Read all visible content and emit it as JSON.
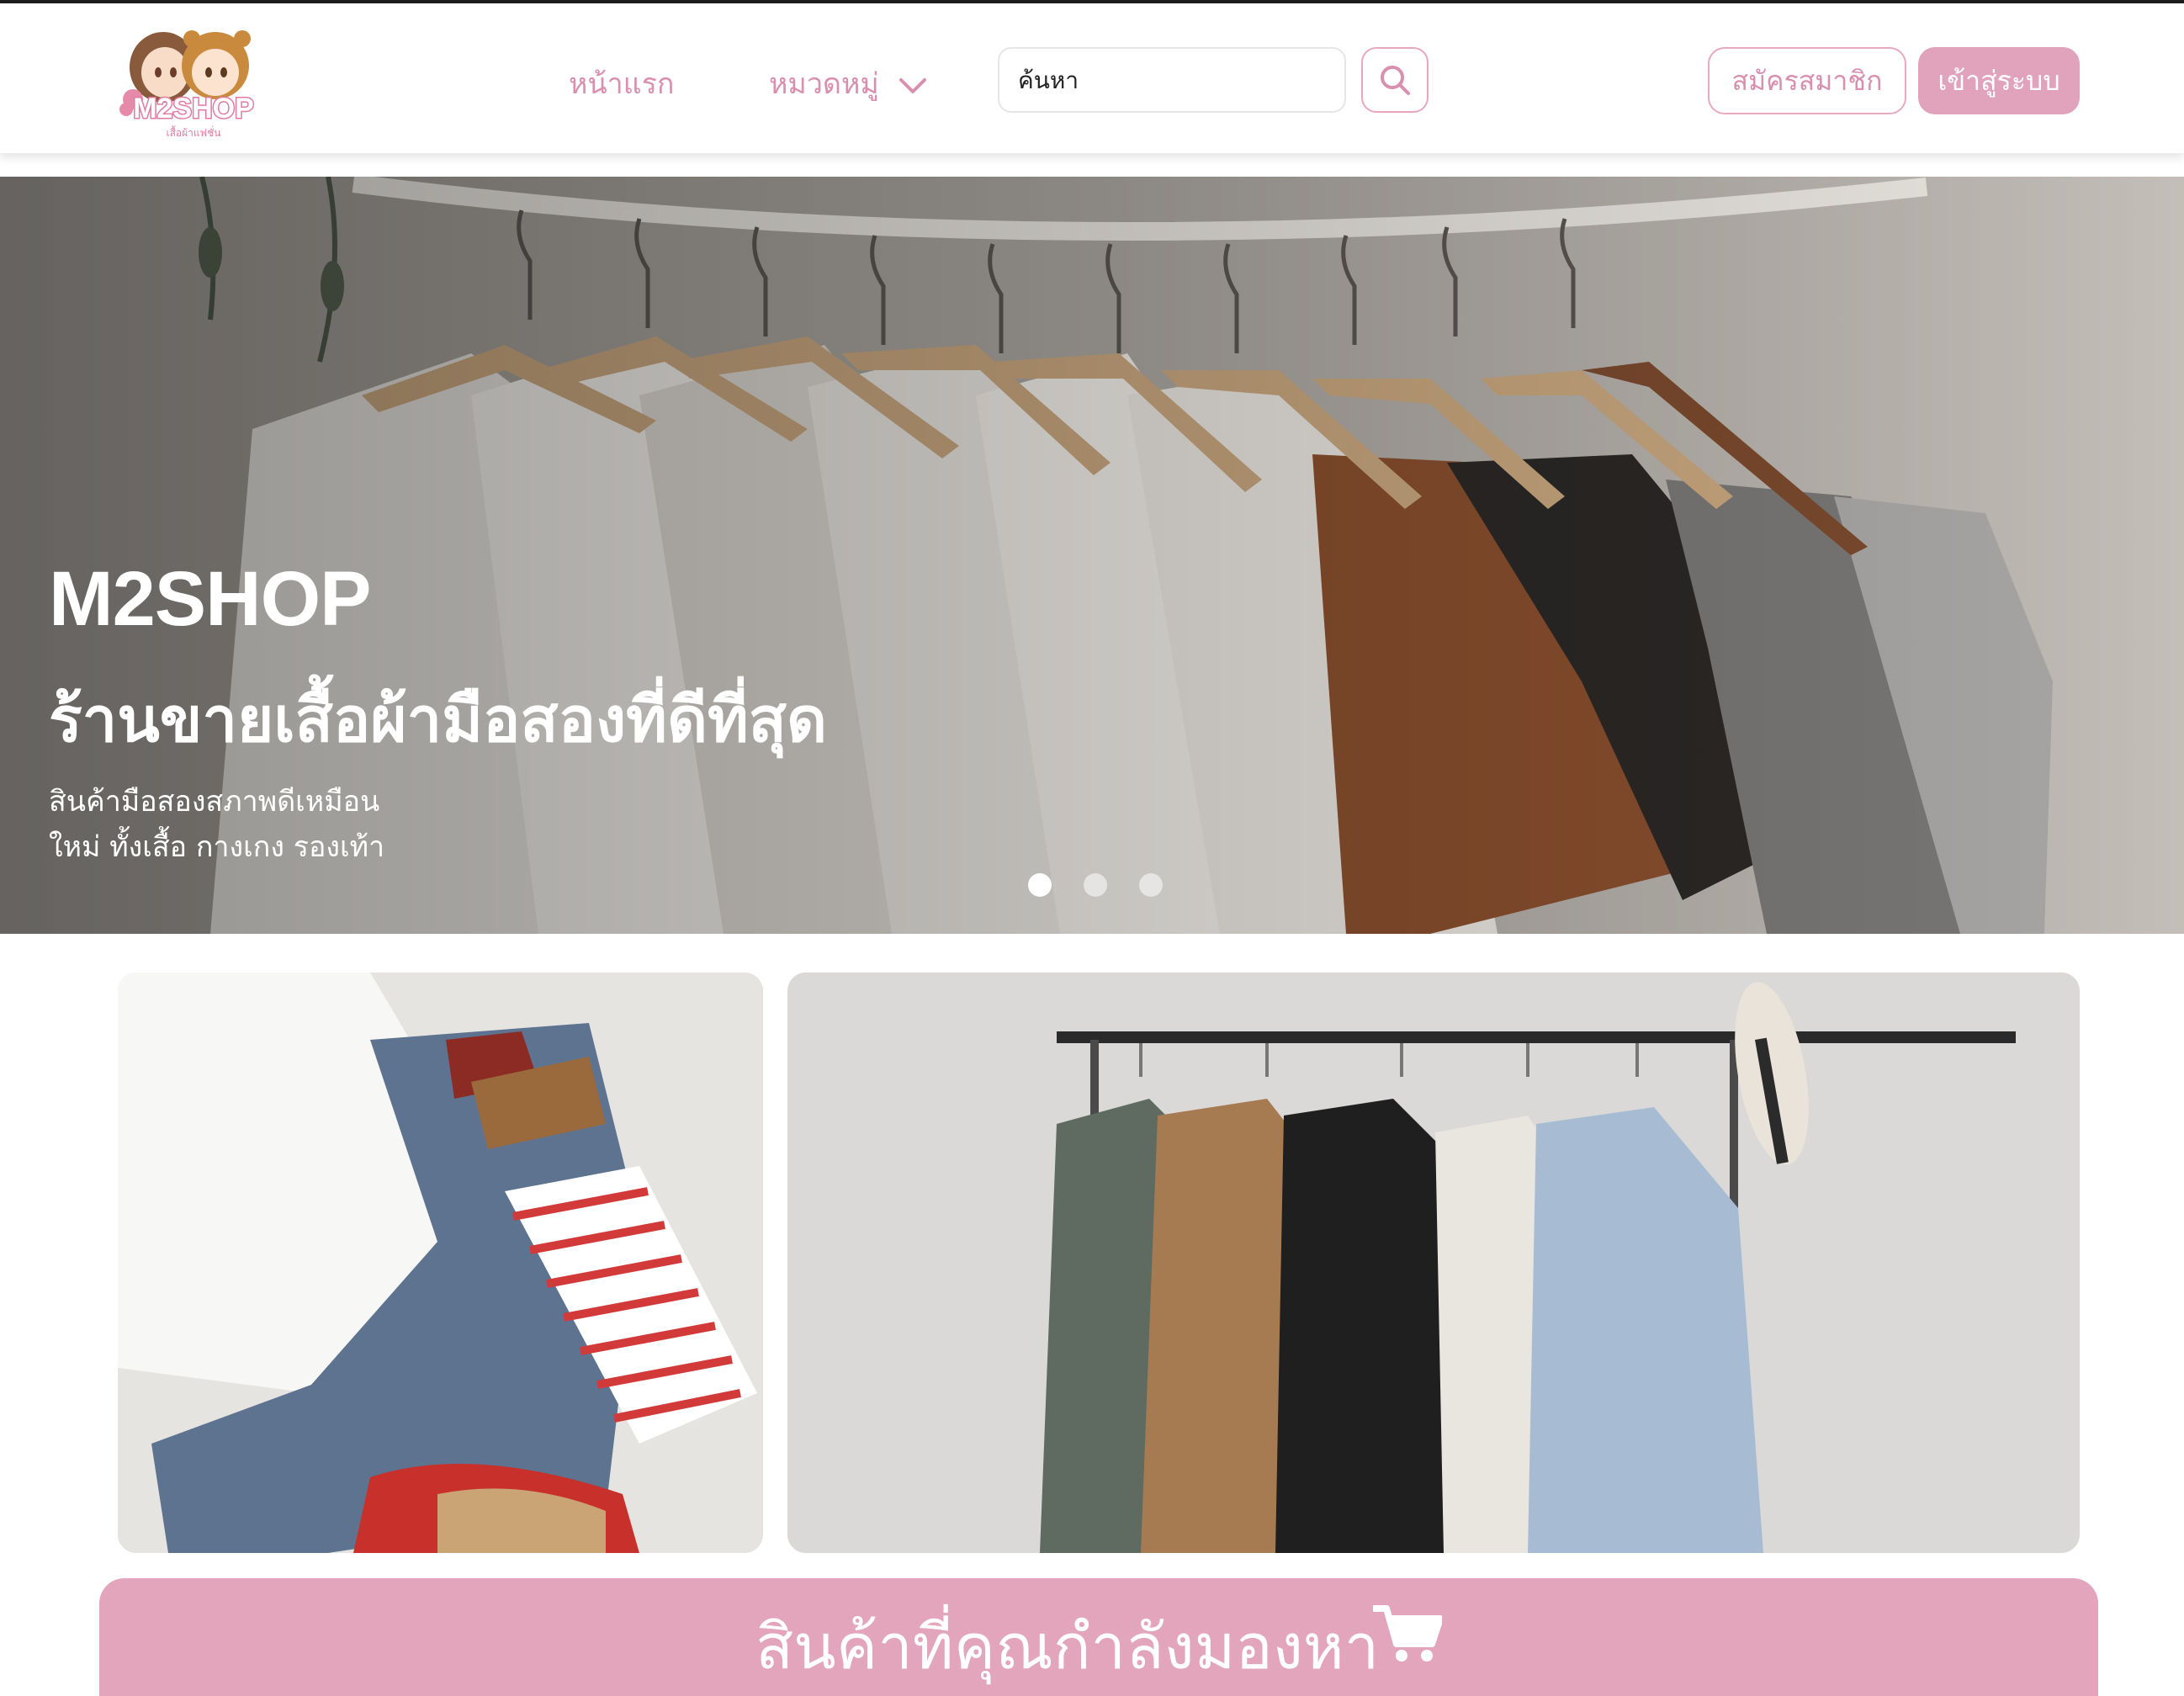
{
  "brand": {
    "logo_text": "M2SHOP",
    "logo_tagline": "เสื้อผ้าแฟชั่น",
    "accent_color": "#e1a2bb"
  },
  "nav": {
    "home_label": "หน้าแรก",
    "category_label": "หมวดหมู่",
    "chevron_icon": "chevron-down-icon"
  },
  "search": {
    "placeholder": "ค้นหา",
    "button_icon": "search-icon"
  },
  "auth": {
    "register_label": "สมัครสมาชิก",
    "login_label": "เข้าสู่ระบบ"
  },
  "hero": {
    "title": "M2SHOP",
    "subtitle": "ร้านขายเสื้อผ้ามือสองที่ดีที่สุด",
    "desc_line1": "สินค้ามือสองสภาพดีเหมือน",
    "desc_line2": "ใหม่ ทั้งเสื้อ กางเกง รองเท้า",
    "slide_count": 3,
    "active_slide": 1
  },
  "section": {
    "title": "สินค้าที่คุณกำลังมองหา",
    "icon": "cart-icon"
  }
}
